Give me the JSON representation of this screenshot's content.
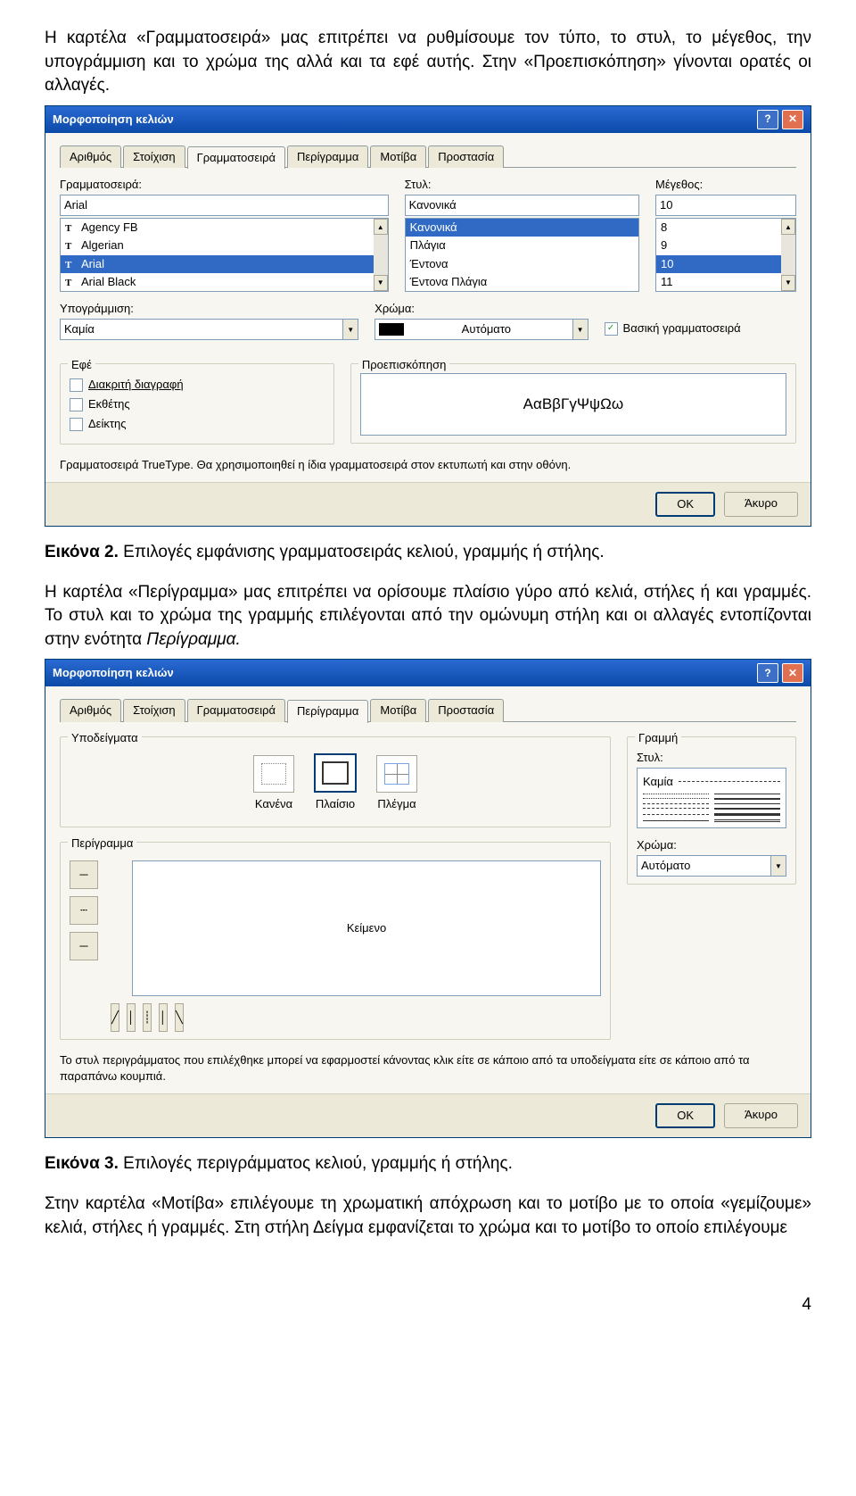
{
  "para1": "Η καρτέλα «Γραμματοσειρά» μας επιτρέπει να ρυθμίσουμε τον τύπο, το στυλ, το μέγεθος, την υπογράμμιση και το χρώμα της αλλά και τα εφέ αυτής. Στην «Προεπισκόπηση» γίνονται ορατές οι αλλαγές.",
  "d1": {
    "title": "Μορφοποίηση κελιών",
    "tabs": [
      "Αριθμός",
      "Στοίχιση",
      "Γραμματοσειρά",
      "Περίγραμμα",
      "Μοτίβα",
      "Προστασία"
    ],
    "font_lbl": "Γραμματοσειρά:",
    "font_val": "Arial",
    "fonts": [
      "Agency FB",
      "Algerian",
      "Arial",
      "Arial Black"
    ],
    "style_lbl": "Στυλ:",
    "style_val": "Κανονικά",
    "styles": [
      "Κανονικά",
      "Πλάγια",
      "Έντονα",
      "Έντονα Πλάγια"
    ],
    "size_lbl": "Μέγεθος:",
    "size_val": "10",
    "sizes": [
      "8",
      "9",
      "10",
      "11"
    ],
    "under_lbl": "Υπογράμμιση:",
    "under_val": "Καμία",
    "color_lbl": "Χρώμα:",
    "color_val": "Αυτόματο",
    "normal_chk": "Βασική γραμματοσειρά",
    "effects_lbl": "Εφέ",
    "strike": "Διακριτή διαγραφή",
    "super": "Εκθέτης",
    "sub": "Δείκτης",
    "preview_lbl": "Προεπισκόπηση",
    "preview_text": "ΑαΒβΓγΨψΩω",
    "info": "Γραμματοσειρά TrueType. Θα χρησιμοποιηθεί η ίδια γραμματοσειρά στον εκτυπωτή και στην οθόνη.",
    "ok": "OK",
    "cancel": "Άκυρο"
  },
  "cap1_b": "Εικόνα 2.",
  "cap1_t": " Επιλογές εμφάνισης γραμματοσειράς κελιού, γραμμής ή στήλης.",
  "para2a": "Η καρτέλα «Περίγραμμα» μας επιτρέπει να ορίσουμε πλαίσιο γύρο από κελιά, στήλες ή και γραμμές. Το στυλ και το χρώμα της γραμμής επιλέγονται από την ομώνυμη στήλη και οι αλλαγές εντοπίζονται στην ενότητα ",
  "para2i": "Περίγραμμα.",
  "d2": {
    "title": "Μορφοποίηση κελιών",
    "tabs": [
      "Αριθμός",
      "Στοίχιση",
      "Γραμματοσειρά",
      "Περίγραμμα",
      "Μοτίβα",
      "Προστασία"
    ],
    "presets_lbl": "Υποδείγματα",
    "p1": "Κανένα",
    "p2": "Πλαίσιο",
    "p3": "Πλέγμα",
    "border_lbl": "Περίγραμμα",
    "text_lbl": "Κείμενο",
    "line_lbl": "Γραμμή",
    "style_lbl": "Στυλ:",
    "none": "Καμία",
    "color_lbl": "Χρώμα:",
    "color_val": "Αυτόματο",
    "info": "Το στυλ περιγράμματος που επιλέχθηκε μπορεί να εφαρμοστεί κάνοντας κλικ είτε σε κάποιο από τα υποδείγματα είτε σε κάποιο από τα παραπάνω κουμπιά.",
    "ok": "OK",
    "cancel": "Άκυρο"
  },
  "cap2_b": "Εικόνα 3.",
  "cap2_t": " Επιλογές περιγράμματος κελιού, γραμμής ή στήλης.",
  "para3": "Στην καρτέλα «Μοτίβα» επιλέγουμε τη χρωματική απόχρωση και το μοτίβο με το οποία «γεμίζουμε» κελιά, στήλες ή γραμμές. Στη στήλη Δείγμα  εμφανίζεται το χρώμα και το μοτίβο το οποίο επιλέγουμε",
  "pagenum": "4"
}
